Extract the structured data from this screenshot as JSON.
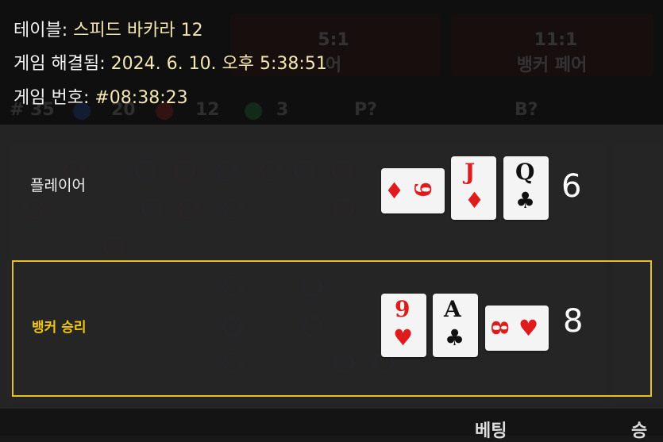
{
  "game_info": {
    "table_label": "테이블: ",
    "table_value": "스피드 바카라 12",
    "resolved_label": "게임 해결됨: ",
    "resolved_value": "2024. 6. 10. 오후 5:38:51",
    "number_label": "게임 번호: ",
    "number_value": "#08:38:23"
  },
  "player": {
    "label": "플레이어",
    "score": "6",
    "cards": [
      {
        "rank": "9",
        "suit": "♦",
        "color": "#e01b1b",
        "orientation": "horizontal"
      },
      {
        "rank": "J",
        "suit": "♦",
        "color": "#e01b1b",
        "orientation": "vertical"
      },
      {
        "rank": "Q",
        "suit": "♣",
        "color": "#111111",
        "orientation": "vertical"
      }
    ]
  },
  "banker": {
    "label": "뱅커 승리",
    "score": "8",
    "cards": [
      {
        "rank": "9",
        "suit": "♥",
        "color": "#e01b1b",
        "orientation": "vertical"
      },
      {
        "rank": "A",
        "suit": "♣",
        "color": "#111111",
        "orientation": "vertical"
      },
      {
        "rank": "8",
        "suit": "♥",
        "color": "#e01b1b",
        "orientation": "horizontal"
      }
    ]
  },
  "background": {
    "bet_tile_1_top": "5:1",
    "bet_tile_1_bottom": "어",
    "bet_tile_2_top": "11:1",
    "bet_tile_2_bottom": "뱅커 페어",
    "stats": [
      "# 35",
      "20",
      "12",
      "3",
      "P?",
      "B?"
    ]
  },
  "footer": {
    "bet_tab": "베팅",
    "win_tab": "승"
  },
  "colors": {
    "accent": "#e8c020",
    "card_red": "#e01b1b",
    "card_black": "#111111"
  }
}
